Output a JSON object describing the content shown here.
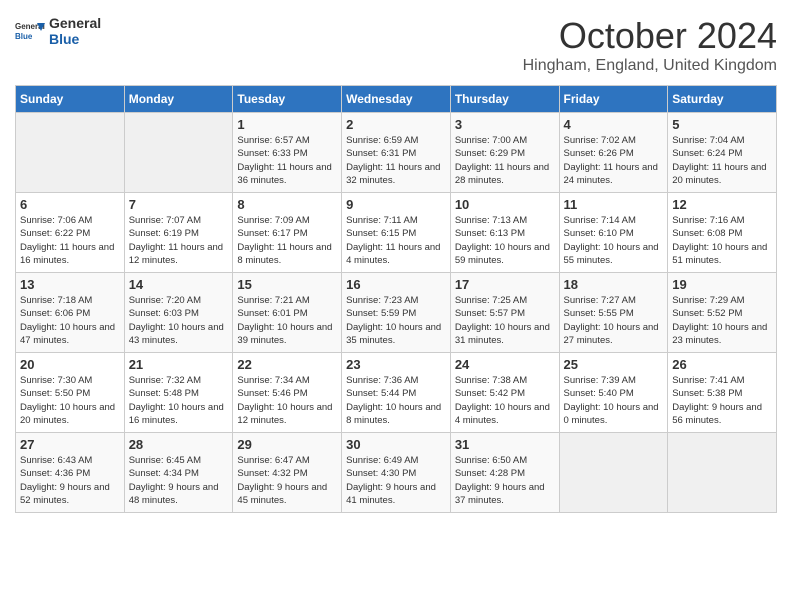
{
  "logo": {
    "general": "General",
    "blue": "Blue"
  },
  "header": {
    "month": "October 2024",
    "location": "Hingham, England, United Kingdom"
  },
  "days_of_week": [
    "Sunday",
    "Monday",
    "Tuesday",
    "Wednesday",
    "Thursday",
    "Friday",
    "Saturday"
  ],
  "weeks": [
    [
      {
        "day": "",
        "info": ""
      },
      {
        "day": "",
        "info": ""
      },
      {
        "day": "1",
        "info": "Sunrise: 6:57 AM\nSunset: 6:33 PM\nDaylight: 11 hours and 36 minutes."
      },
      {
        "day": "2",
        "info": "Sunrise: 6:59 AM\nSunset: 6:31 PM\nDaylight: 11 hours and 32 minutes."
      },
      {
        "day": "3",
        "info": "Sunrise: 7:00 AM\nSunset: 6:29 PM\nDaylight: 11 hours and 28 minutes."
      },
      {
        "day": "4",
        "info": "Sunrise: 7:02 AM\nSunset: 6:26 PM\nDaylight: 11 hours and 24 minutes."
      },
      {
        "day": "5",
        "info": "Sunrise: 7:04 AM\nSunset: 6:24 PM\nDaylight: 11 hours and 20 minutes."
      }
    ],
    [
      {
        "day": "6",
        "info": "Sunrise: 7:06 AM\nSunset: 6:22 PM\nDaylight: 11 hours and 16 minutes."
      },
      {
        "day": "7",
        "info": "Sunrise: 7:07 AM\nSunset: 6:19 PM\nDaylight: 11 hours and 12 minutes."
      },
      {
        "day": "8",
        "info": "Sunrise: 7:09 AM\nSunset: 6:17 PM\nDaylight: 11 hours and 8 minutes."
      },
      {
        "day": "9",
        "info": "Sunrise: 7:11 AM\nSunset: 6:15 PM\nDaylight: 11 hours and 4 minutes."
      },
      {
        "day": "10",
        "info": "Sunrise: 7:13 AM\nSunset: 6:13 PM\nDaylight: 10 hours and 59 minutes."
      },
      {
        "day": "11",
        "info": "Sunrise: 7:14 AM\nSunset: 6:10 PM\nDaylight: 10 hours and 55 minutes."
      },
      {
        "day": "12",
        "info": "Sunrise: 7:16 AM\nSunset: 6:08 PM\nDaylight: 10 hours and 51 minutes."
      }
    ],
    [
      {
        "day": "13",
        "info": "Sunrise: 7:18 AM\nSunset: 6:06 PM\nDaylight: 10 hours and 47 minutes."
      },
      {
        "day": "14",
        "info": "Sunrise: 7:20 AM\nSunset: 6:03 PM\nDaylight: 10 hours and 43 minutes."
      },
      {
        "day": "15",
        "info": "Sunrise: 7:21 AM\nSunset: 6:01 PM\nDaylight: 10 hours and 39 minutes."
      },
      {
        "day": "16",
        "info": "Sunrise: 7:23 AM\nSunset: 5:59 PM\nDaylight: 10 hours and 35 minutes."
      },
      {
        "day": "17",
        "info": "Sunrise: 7:25 AM\nSunset: 5:57 PM\nDaylight: 10 hours and 31 minutes."
      },
      {
        "day": "18",
        "info": "Sunrise: 7:27 AM\nSunset: 5:55 PM\nDaylight: 10 hours and 27 minutes."
      },
      {
        "day": "19",
        "info": "Sunrise: 7:29 AM\nSunset: 5:52 PM\nDaylight: 10 hours and 23 minutes."
      }
    ],
    [
      {
        "day": "20",
        "info": "Sunrise: 7:30 AM\nSunset: 5:50 PM\nDaylight: 10 hours and 20 minutes."
      },
      {
        "day": "21",
        "info": "Sunrise: 7:32 AM\nSunset: 5:48 PM\nDaylight: 10 hours and 16 minutes."
      },
      {
        "day": "22",
        "info": "Sunrise: 7:34 AM\nSunset: 5:46 PM\nDaylight: 10 hours and 12 minutes."
      },
      {
        "day": "23",
        "info": "Sunrise: 7:36 AM\nSunset: 5:44 PM\nDaylight: 10 hours and 8 minutes."
      },
      {
        "day": "24",
        "info": "Sunrise: 7:38 AM\nSunset: 5:42 PM\nDaylight: 10 hours and 4 minutes."
      },
      {
        "day": "25",
        "info": "Sunrise: 7:39 AM\nSunset: 5:40 PM\nDaylight: 10 hours and 0 minutes."
      },
      {
        "day": "26",
        "info": "Sunrise: 7:41 AM\nSunset: 5:38 PM\nDaylight: 9 hours and 56 minutes."
      }
    ],
    [
      {
        "day": "27",
        "info": "Sunrise: 6:43 AM\nSunset: 4:36 PM\nDaylight: 9 hours and 52 minutes."
      },
      {
        "day": "28",
        "info": "Sunrise: 6:45 AM\nSunset: 4:34 PM\nDaylight: 9 hours and 48 minutes."
      },
      {
        "day": "29",
        "info": "Sunrise: 6:47 AM\nSunset: 4:32 PM\nDaylight: 9 hours and 45 minutes."
      },
      {
        "day": "30",
        "info": "Sunrise: 6:49 AM\nSunset: 4:30 PM\nDaylight: 9 hours and 41 minutes."
      },
      {
        "day": "31",
        "info": "Sunrise: 6:50 AM\nSunset: 4:28 PM\nDaylight: 9 hours and 37 minutes."
      },
      {
        "day": "",
        "info": ""
      },
      {
        "day": "",
        "info": ""
      }
    ]
  ]
}
